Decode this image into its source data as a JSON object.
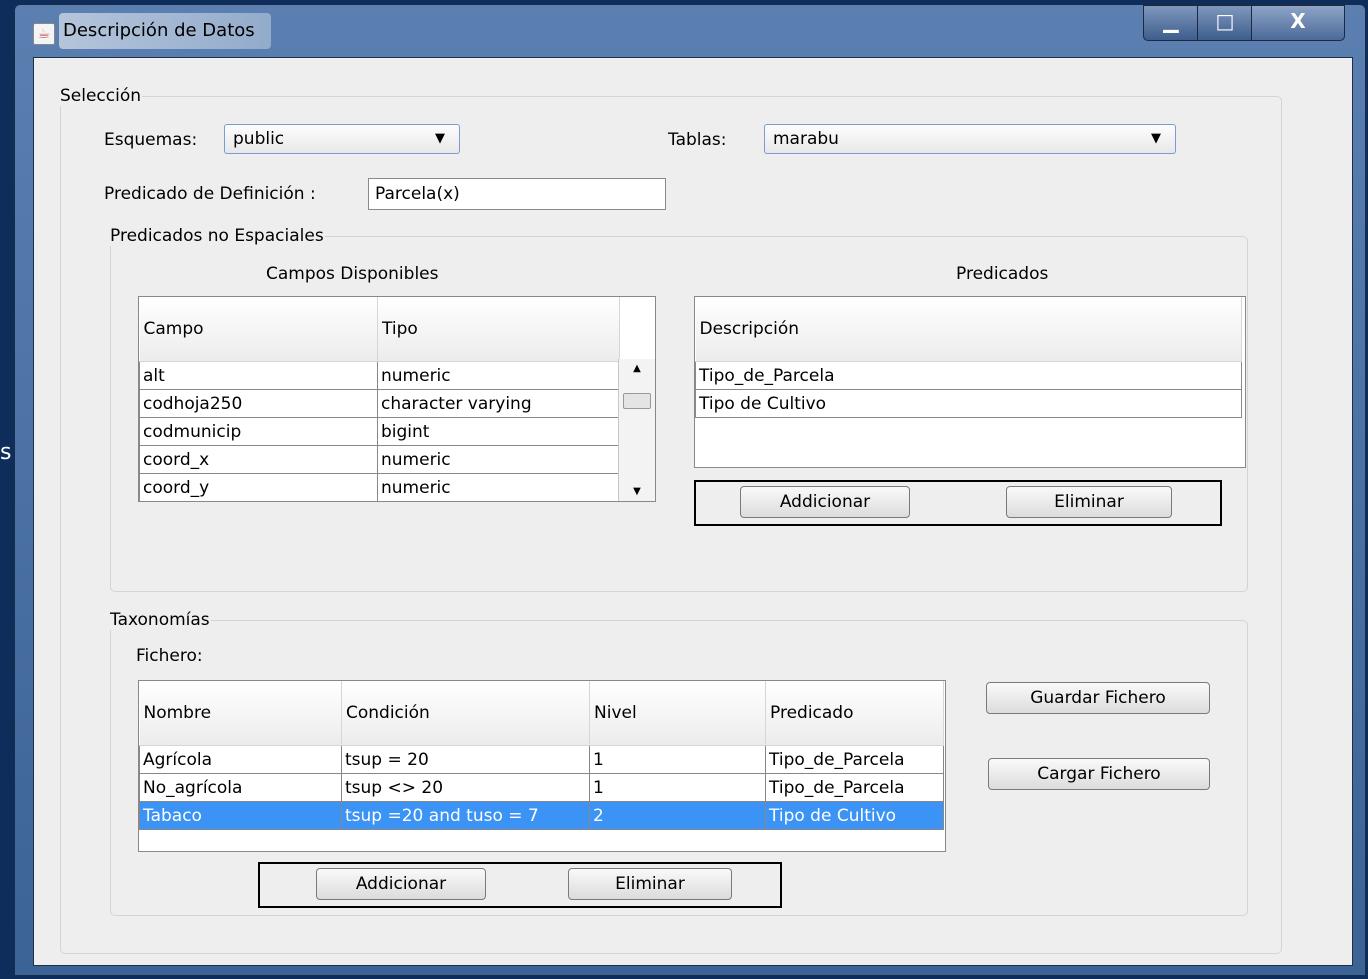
{
  "window": {
    "title": "Descripción de Datos",
    "controls": {
      "minimize": "▁",
      "maximize": "□",
      "close": "X"
    }
  },
  "stray_text": "s",
  "seleccion": {
    "legend": "Selección",
    "esquemas_label": "Esquemas:",
    "esquemas_value": "public",
    "tablas_label": "Tablas:",
    "tablas_value": "marabu",
    "predicado_label": "Predicado de Definición :",
    "predicado_value": "Parcela(x)"
  },
  "no_espaciales": {
    "legend": "Predicados no Espaciales",
    "campos_title": "Campos Disponibles",
    "predicados_title": "Predicados",
    "campos_columns": [
      "Campo",
      "Tipo"
    ],
    "campos_rows": [
      [
        "alt",
        "numeric"
      ],
      [
        "codhoja250",
        "character varying"
      ],
      [
        "codmunicip",
        "bigint"
      ],
      [
        "coord_x",
        "numeric"
      ],
      [
        "coord_y",
        "numeric"
      ]
    ],
    "predicados_columns": [
      "Descripción"
    ],
    "predicados_rows": [
      [
        "Tipo_de_Parcela"
      ],
      [
        "Tipo de Cultivo"
      ]
    ],
    "add_label": "Addicionar",
    "remove_label": "Eliminar"
  },
  "taxonomias": {
    "legend": "Taxonomías",
    "fichero_label": "Fichero:",
    "columns": [
      "Nombre",
      "Condición",
      "Nivel",
      "Predicado"
    ],
    "rows": [
      [
        "Agrícola",
        "tsup = 20",
        "1",
        "Tipo_de_Parcela"
      ],
      [
        "No_agrícola",
        "tsup <> 20",
        "1",
        "Tipo_de_Parcela"
      ],
      [
        "Tabaco",
        "tsup =20 and tuso = 7",
        "2",
        "Tipo de Cultivo"
      ]
    ],
    "selected_row": 2,
    "guardar_label": "Guardar Fichero",
    "cargar_label": "Cargar Fichero",
    "add_label": "Addicionar",
    "remove_label": "Eliminar"
  }
}
